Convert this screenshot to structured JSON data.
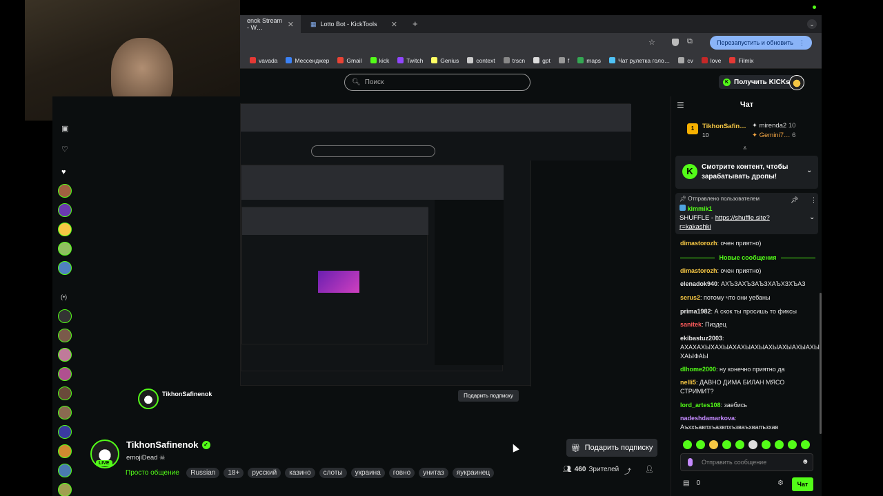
{
  "browser": {
    "tabs": [
      {
        "label": "enok Stream - W…",
        "active": true
      },
      {
        "label": "Lotto Bot - KickTools",
        "active": false
      }
    ],
    "relaunch_label": "Перезапустить и обновить",
    "bookmarks": [
      {
        "label": "vavada",
        "color": "#e53935"
      },
      {
        "label": "Мессенджер",
        "color": "#3b82f6"
      },
      {
        "label": "Gmail",
        "color": "#ea4335"
      },
      {
        "label": "kick",
        "color": "#53fc18"
      },
      {
        "label": "Twitch",
        "color": "#9146ff"
      },
      {
        "label": "Genius",
        "color": "#ffff64"
      },
      {
        "label": "context",
        "color": "#cccccc"
      },
      {
        "label": "trscn",
        "color": "#888888"
      },
      {
        "label": "gpt",
        "color": "#dddddd"
      },
      {
        "label": "f",
        "color": "#999999"
      },
      {
        "label": "maps",
        "color": "#34a853"
      },
      {
        "label": "Чат рулетка голо…",
        "color": "#4fc3f7"
      },
      {
        "label": "cv",
        "color": "#aaaaaa"
      },
      {
        "label": "love",
        "color": "#c62828"
      },
      {
        "label": "Filmix",
        "color": "#e53935"
      }
    ]
  },
  "header": {
    "search_placeholder": "Поиск",
    "get_kicks_label": "Получить KICKs"
  },
  "streamer": {
    "name": "TikhonSafinenok",
    "subtitle": "emojiDead ☠",
    "live_label": "LIVE",
    "category": "Просто общение",
    "tags": [
      "Russian",
      "18+",
      "русский",
      "казино",
      "слоты",
      "украина",
      "говно",
      "унитаз",
      "яукраинец"
    ],
    "gift_sub_label": "Подарить подписку",
    "viewers": "460",
    "viewers_label": "Зрителей"
  },
  "chat": {
    "title": "Чат",
    "leaderboard": [
      {
        "name": "TikhonSafin…",
        "value": "10",
        "rank": "1"
      },
      {
        "name": "mirenda2",
        "value": "10"
      },
      {
        "name": "Gemini7…",
        "value": "6"
      }
    ],
    "drops_banner": "Смотрите контент, чтобы зарабатывать дропы!",
    "pinned_by_label": "Отправлено пользователем",
    "pinned_user": "kimmik1",
    "pinned_text": "SHUFFLE - ",
    "pinned_link": "https://shuffle.site?r=kakashki",
    "new_messages_label": "Новые сообщения",
    "messages": [
      {
        "user": "dimastorozh",
        "color": "#f6c744",
        "text": "очен приятно)"
      },
      {
        "user": "dimastorozh",
        "color": "#f6c744",
        "text": "очен приятно)"
      },
      {
        "user": "elenadok940",
        "color": "#e8e8e8",
        "text": "АХЪЗАХЪЗАЪЗХАЪХЗХЪАЗ"
      },
      {
        "user": "serus2",
        "color": "#f6c744",
        "text": "потому что они уебаны"
      },
      {
        "user": "prima1982",
        "color": "#e8e8e8",
        "text": "А скок ты просишь то фиксы"
      },
      {
        "user": "sanitek",
        "color": "#ff5c5c",
        "text": "Пиздец"
      },
      {
        "user": "ekibastuz2003",
        "color": "#e8e8e8",
        "text": "АХАХАХЫХАХЫАХАХЫАХЫАХЫАХЫАХЫАХЫ ХАЫФАЫ"
      },
      {
        "user": "dlhome2000",
        "color": "#53fc18",
        "text": "ну конечно приятно да"
      },
      {
        "user": "nelli5",
        "color": "#f6c744",
        "text": "ДАВНО ДИМА БИЛАН МЯСО СТРИМИТ?"
      },
      {
        "user": "lord_artes108",
        "color": "#53fc18",
        "text": "заебись"
      },
      {
        "user": "nadeshdamarkova",
        "color": "#c58aff",
        "text": "Аъххъавпхъазвпхъзваъхвапъзхав"
      }
    ],
    "input_placeholder": "Отправить сообщение",
    "kicks_balance": "0",
    "send_label": "Чат"
  },
  "colors": {
    "accent": "#53fc18",
    "bg": "#0b0e0f"
  }
}
